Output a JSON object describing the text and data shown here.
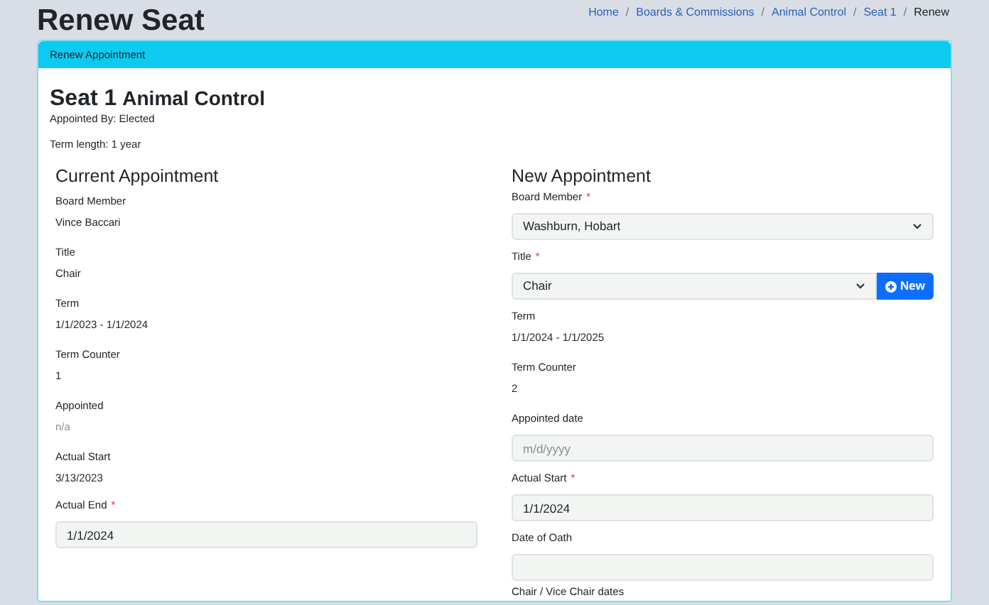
{
  "page_title": "Renew Seat",
  "breadcrumb": [
    {
      "label": "Home",
      "current": false
    },
    {
      "separator": "/",
      "label": "Boards & Commissions",
      "current": false
    },
    {
      "separator": "/",
      "label": "Animal Control",
      "current": false
    },
    {
      "separator": "/",
      "label": "Seat 1",
      "current": false
    },
    {
      "separator": "/",
      "label": "Renew",
      "current": true
    }
  ],
  "card": {
    "header": "Renew Appointment",
    "seat": "Seat 1",
    "board": "Animal Control",
    "appointed_by": "Appointed By: Elected",
    "term_length": "Term length: 1 year"
  },
  "current": {
    "title": "Current Appointment",
    "fields": [
      {
        "kind": "text",
        "label": "Board Member",
        "value": "Vince Baccari",
        "muted": false
      },
      {
        "kind": "text",
        "label": "Title",
        "value": "Chair",
        "muted": false
      },
      {
        "kind": "text",
        "label": "Term",
        "value": "1/1/2023 - 1/1/2024",
        "muted": false
      },
      {
        "kind": "text",
        "label": "Term Counter",
        "value": "1",
        "muted": false
      },
      {
        "kind": "text",
        "label": "Appointed",
        "value": "n/a",
        "muted": true
      },
      {
        "kind": "text",
        "label": "Actual Start",
        "value": "3/13/2023",
        "muted": false
      },
      {
        "kind": "input",
        "label": "Actual End",
        "value": "1/1/2024",
        "required_mark": "*"
      }
    ]
  },
  "new": {
    "title": "New Appointment",
    "fields": [
      {
        "kind": "select",
        "label": "Board Member",
        "value": "Washburn, Hobart",
        "required_mark": "*"
      },
      {
        "kind": "select_button",
        "label": "Title",
        "value": "Chair",
        "required_mark": "*",
        "button": "New"
      },
      {
        "kind": "text",
        "label": "Term",
        "value": "1/1/2024 - 1/1/2025",
        "muted": false
      },
      {
        "kind": "text",
        "label": "Term Counter",
        "value": "2",
        "muted": false
      },
      {
        "kind": "input",
        "label": "Appointed date",
        "placeholder": "m/d/yyyy"
      },
      {
        "kind": "input",
        "label": "Actual Start",
        "value": "1/1/2024",
        "required_mark": "*"
      },
      {
        "kind": "input",
        "label": "Date of Oath"
      },
      {
        "kind": "label",
        "label": "Chair / Vice Chair dates"
      }
    ]
  }
}
